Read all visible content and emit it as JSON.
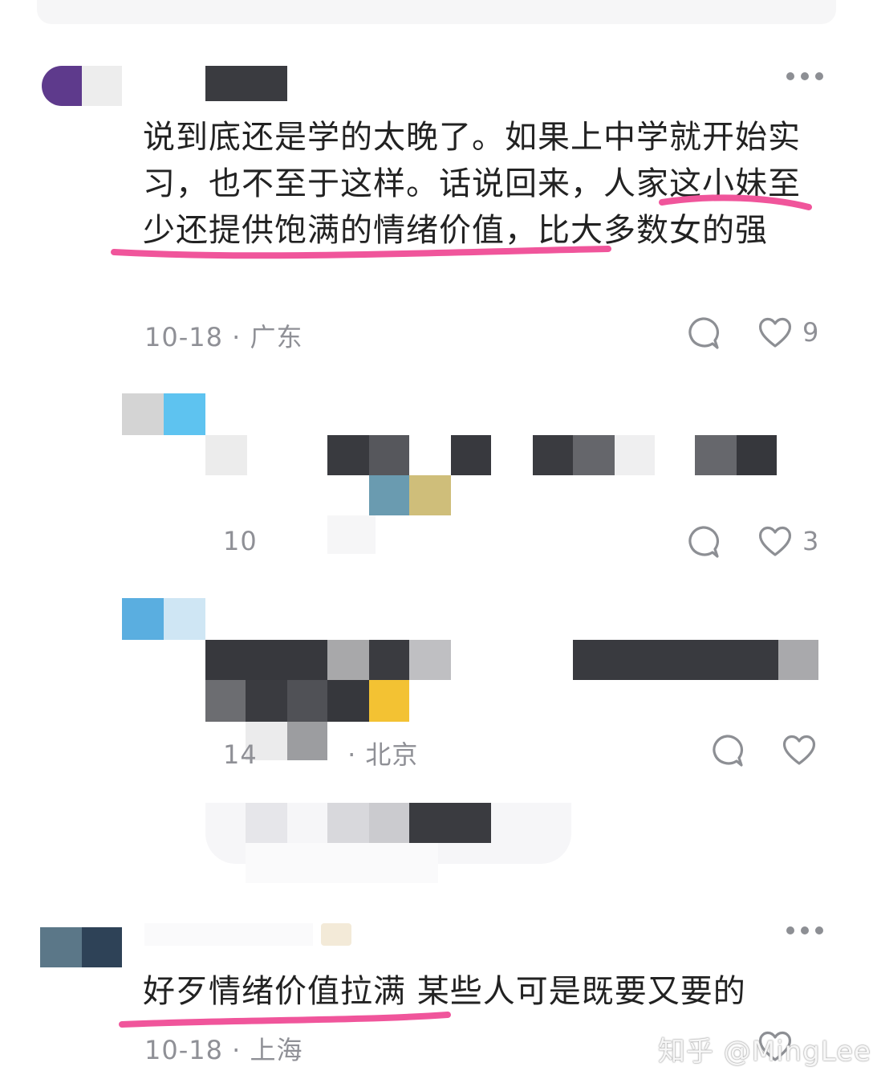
{
  "comments": [
    {
      "text": "说到底还是学的太晚了。如果上中学就开始实习，也不至于这样。话说回来，人家这小妹至少还提供饱满的情绪价值，比大多数女的强",
      "date": "10-18",
      "location": "广东",
      "like_count": "9"
    },
    {
      "date": "10",
      "like_count": "3"
    },
    {
      "date": "14",
      "location": "北京"
    },
    {
      "text": "好歹情绪价值拉满 某些人可是既要又要的",
      "date": "10-18",
      "location": "上海"
    }
  ],
  "separator": "·",
  "watermark": "知乎 @MingLee",
  "highlight_color": "#f0559b",
  "icons": [
    "more-icon",
    "comment-icon",
    "heart-icon"
  ]
}
